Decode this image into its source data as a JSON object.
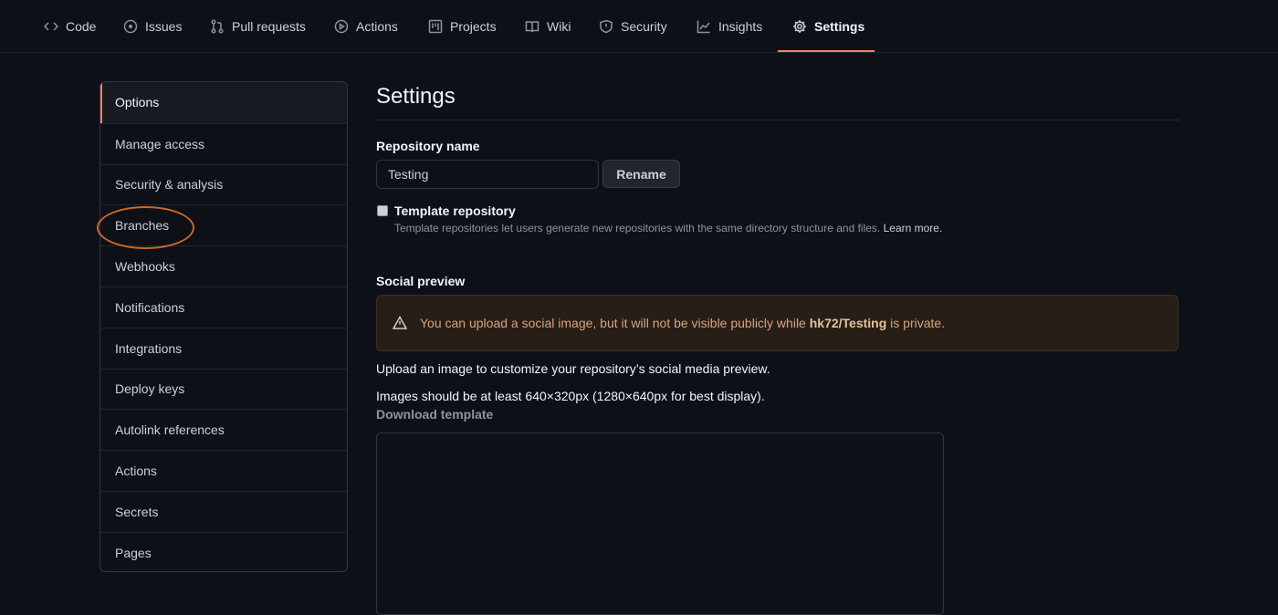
{
  "nav": {
    "tabs": [
      {
        "label": "Code",
        "icon": "code-icon"
      },
      {
        "label": "Issues",
        "icon": "issue-icon"
      },
      {
        "label": "Pull requests",
        "icon": "pull-request-icon"
      },
      {
        "label": "Actions",
        "icon": "play-icon"
      },
      {
        "label": "Projects",
        "icon": "project-icon"
      },
      {
        "label": "Wiki",
        "icon": "book-icon"
      },
      {
        "label": "Security",
        "icon": "shield-icon"
      },
      {
        "label": "Insights",
        "icon": "graph-icon"
      },
      {
        "label": "Settings",
        "icon": "gear-icon",
        "selected": true
      }
    ]
  },
  "sidebar": {
    "items": [
      {
        "label": "Options",
        "active": true
      },
      {
        "label": "Manage access"
      },
      {
        "label": "Security & analysis"
      },
      {
        "label": "Branches",
        "highlighted": true
      },
      {
        "label": "Webhooks"
      },
      {
        "label": "Notifications"
      },
      {
        "label": "Integrations"
      },
      {
        "label": "Deploy keys"
      },
      {
        "label": "Autolink references"
      },
      {
        "label": "Actions"
      },
      {
        "label": "Secrets"
      },
      {
        "label": "Pages"
      }
    ]
  },
  "main": {
    "title": "Settings",
    "repo_name_label": "Repository name",
    "repo_name_value": "Testing",
    "rename_label": "Rename",
    "template_label": "Template repository",
    "template_help": "Template repositories let users generate new repositories with the same directory structure and files.",
    "learn_more": "Learn more.",
    "social_preview_label": "Social preview",
    "flash": {
      "prefix": "You can upload a social image, but it will not be visible publicly while",
      "repo": "hk72/Testing",
      "suffix": "is private."
    },
    "upload_text": "Upload an image to customize your repository’s social media preview.",
    "size_text": "Images should be at least 640×320px (1280×640px for best display).",
    "download_template": "Download template"
  },
  "colors": {
    "accent": "#f78166",
    "highlight_ring": "#d0662a",
    "background": "#0d1117"
  }
}
